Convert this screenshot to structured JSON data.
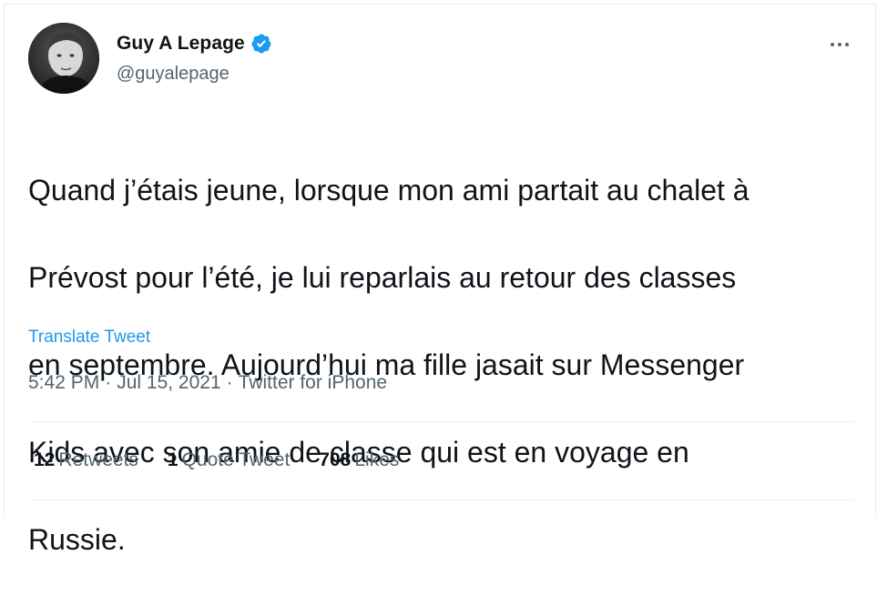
{
  "author": {
    "display_name": "Guy A Lepage",
    "handle": "@guyalepage",
    "verified": true,
    "avatar_icon": "profile-photo"
  },
  "tweet": {
    "text_lines": [
      "Quand j’étais jeune, lorsque mon ami partait au chalet à",
      "Prévost pour l’été, je lui reparlais au retour des classes",
      "en septembre. Aujourd’hui ma fille jasait sur Messenger",
      "Kids avec son amie de classe qui est en voyage en",
      "Russie."
    ],
    "translate_label": "Translate Tweet",
    "time": "5:42 PM",
    "date": "Jul 15, 2021",
    "source": "Twitter for iPhone",
    "separator": "·"
  },
  "stats": {
    "retweets_count": "12",
    "retweets_label": "Retweets",
    "quotes_count": "1",
    "quotes_label": "Quote Tweet",
    "likes_count": "708",
    "likes_label": "Likes"
  },
  "colors": {
    "accent": "#1d9bf0",
    "text_primary": "#0f1419",
    "text_secondary": "#536471",
    "divider": "#eff3f4"
  }
}
